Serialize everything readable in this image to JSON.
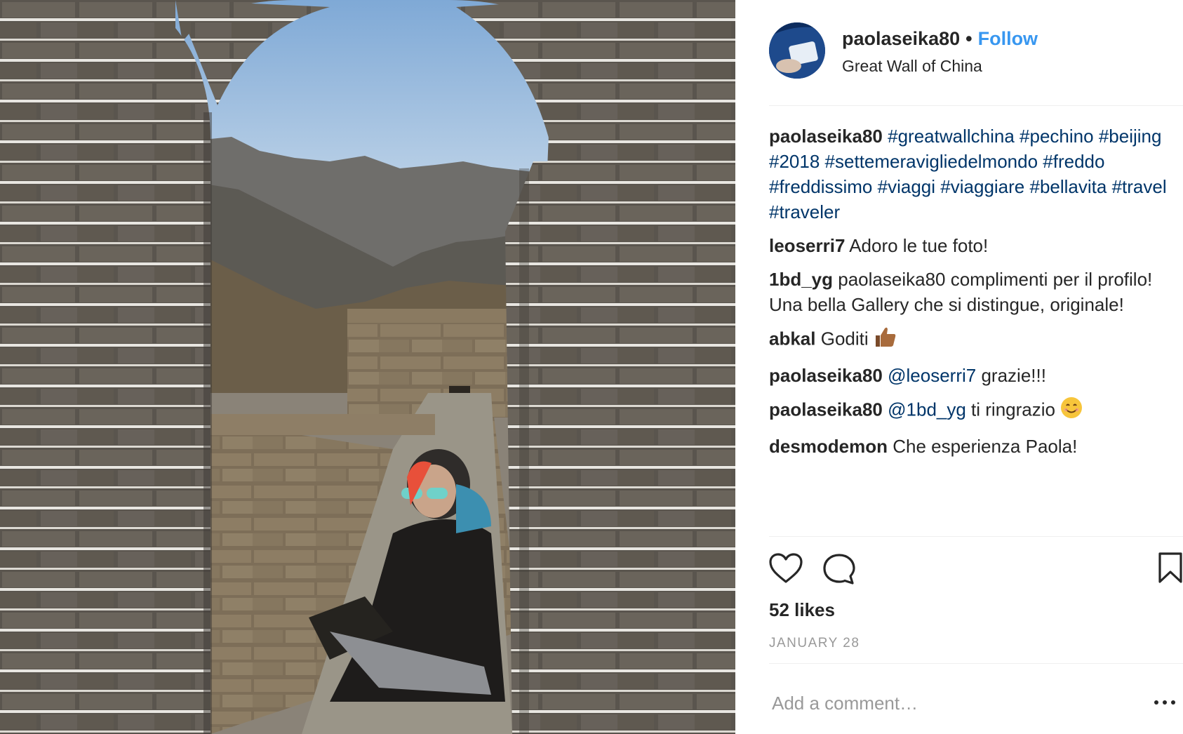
{
  "post": {
    "username": "paolaseika80",
    "separator": "•",
    "follow_label": "Follow",
    "location": "Great Wall of China"
  },
  "comments": [
    {
      "user": "paolaseika80",
      "parts": [
        {
          "text": "#greatwallchina",
          "type": "tag"
        },
        {
          "text": " ",
          "type": "text"
        },
        {
          "text": "#pechino",
          "type": "tag"
        },
        {
          "text": " ",
          "type": "text"
        },
        {
          "text": "#beijing",
          "type": "tag"
        },
        {
          "text": " ",
          "type": "text"
        },
        {
          "text": "#2018",
          "type": "tag"
        },
        {
          "text": " ",
          "type": "text"
        },
        {
          "text": "#settemeravigliedelmondo",
          "type": "tag"
        },
        {
          "text": " ",
          "type": "text"
        },
        {
          "text": "#freddo",
          "type": "tag"
        },
        {
          "text": " ",
          "type": "text"
        },
        {
          "text": "#freddissimo",
          "type": "tag"
        },
        {
          "text": " ",
          "type": "text"
        },
        {
          "text": "#viaggi",
          "type": "tag"
        },
        {
          "text": " ",
          "type": "text"
        },
        {
          "text": "#viaggiare",
          "type": "tag"
        },
        {
          "text": " ",
          "type": "text"
        },
        {
          "text": "#bellavita",
          "type": "tag"
        },
        {
          "text": " ",
          "type": "text"
        },
        {
          "text": "#travel",
          "type": "tag"
        },
        {
          "text": " ",
          "type": "text"
        },
        {
          "text": "#traveler",
          "type": "tag"
        }
      ]
    },
    {
      "user": "leoserri7",
      "parts": [
        {
          "text": "Adoro le tue foto!",
          "type": "text"
        }
      ]
    },
    {
      "user": "1bd_yg",
      "parts": [
        {
          "text": "paolaseika80 complimenti per il profilo! Una bella Gallery che si distingue, originale!",
          "type": "text"
        }
      ]
    },
    {
      "user": "abkal",
      "parts": [
        {
          "text": "Goditi ",
          "type": "text"
        },
        {
          "text": "thumbs-up-emoji",
          "type": "emoji"
        }
      ]
    },
    {
      "user": "paolaseika80",
      "parts": [
        {
          "text": "@leoserri7",
          "type": "tag"
        },
        {
          "text": " grazie!!!",
          "type": "text"
        }
      ]
    },
    {
      "user": "paolaseika80",
      "parts": [
        {
          "text": "@1bd_yg",
          "type": "tag"
        },
        {
          "text": " ti ringrazio ",
          "type": "text"
        },
        {
          "text": "smile-emoji",
          "type": "emoji"
        }
      ]
    },
    {
      "user": "desmodemon",
      "parts": [
        {
          "text": "Che esperienza Paola!",
          "type": "text"
        }
      ]
    }
  ],
  "actions": {
    "like_icon": "heart-icon",
    "comment_icon": "comment-icon",
    "save_icon": "bookmark-icon",
    "more_icon": "ellipsis-icon"
  },
  "likes_text": "52 likes",
  "date_text": "JANUARY 28",
  "add_comment_placeholder": "Add a comment…",
  "colors": {
    "link": "#003569",
    "follow": "#3897f0",
    "text": "#262626",
    "muted": "#999999",
    "divider": "#efefef"
  }
}
